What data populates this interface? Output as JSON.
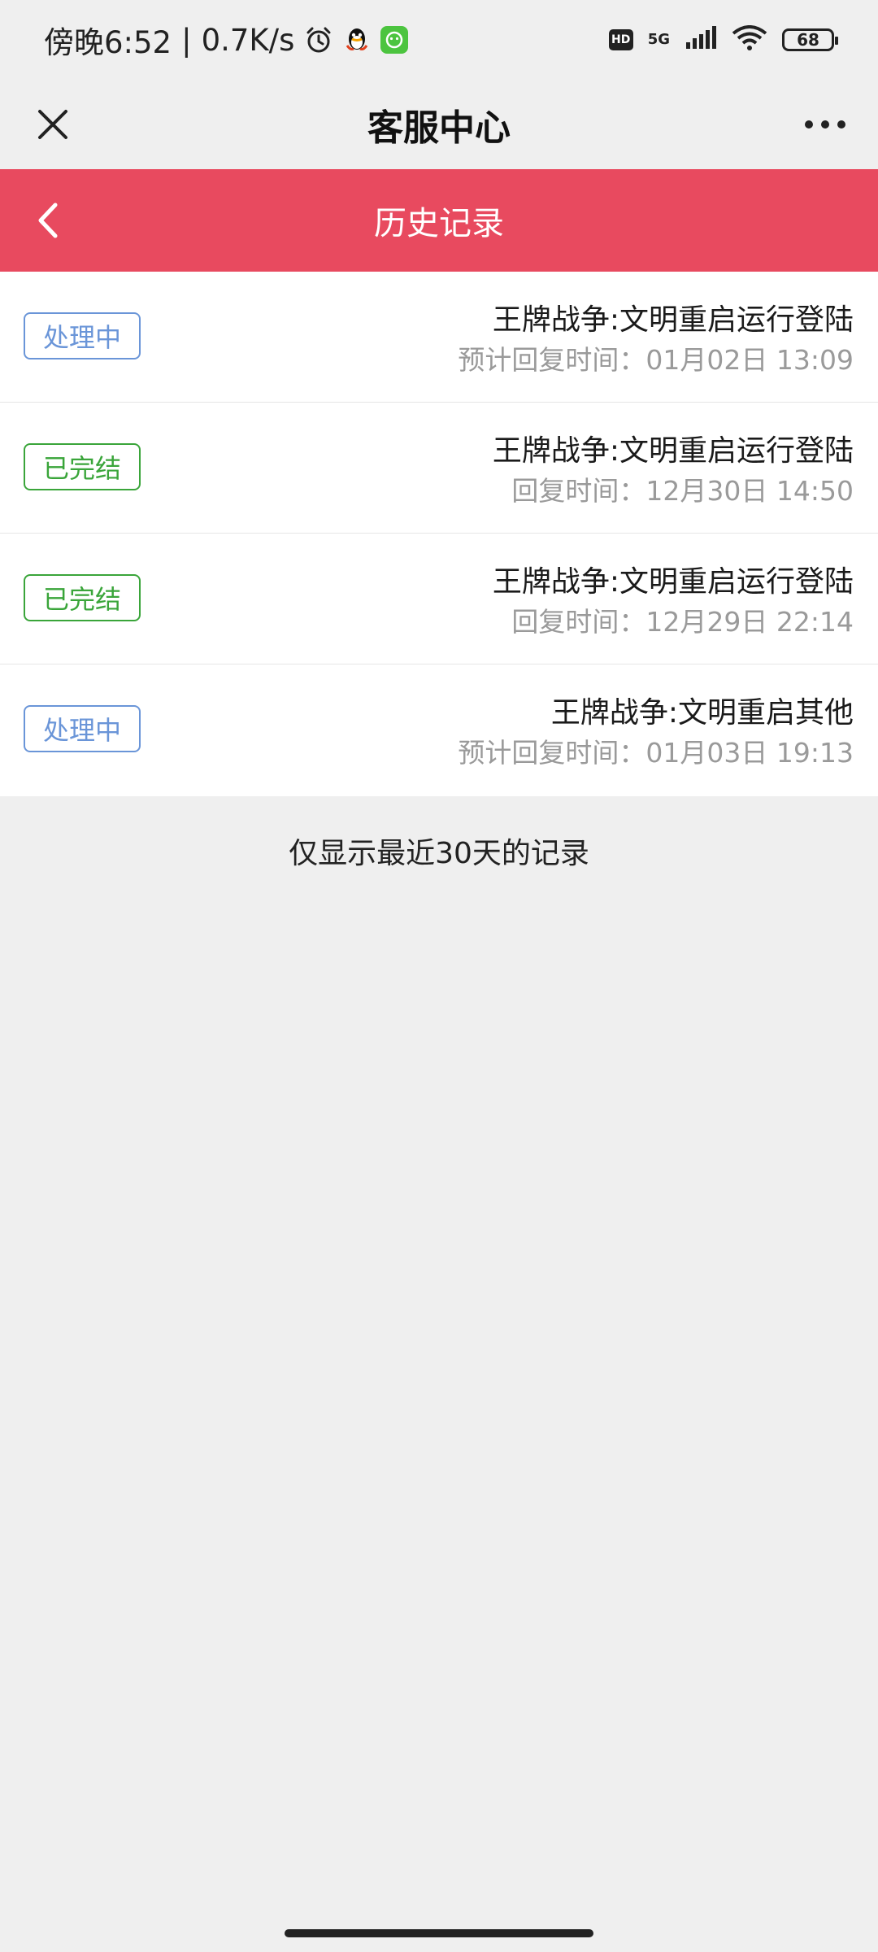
{
  "status_bar": {
    "time": "傍晚6:52",
    "network_speed": "0.7K/s",
    "icons_left": [
      "alarm-icon",
      "qq-icon",
      "app-badge-icon"
    ],
    "hd": "HD",
    "network_type": "5G",
    "battery": "68"
  },
  "title_bar": {
    "title": "客服中心",
    "close_icon": "close-icon",
    "more_icon": "more-icon"
  },
  "header": {
    "title": "历史记录",
    "back_icon": "chevron-left-icon",
    "color": "#e84a5f"
  },
  "records": [
    {
      "status": "处理中",
      "status_type": "processing",
      "title": "王牌战争:文明重启运行登陆",
      "time": "预计回复时间：01月02日 13:09"
    },
    {
      "status": "已完结",
      "status_type": "done",
      "title": "王牌战争:文明重启运行登陆",
      "time": "回复时间：12月30日 14:50"
    },
    {
      "status": "已完结",
      "status_type": "done",
      "title": "王牌战争:文明重启运行登陆",
      "time": "回复时间：12月29日 22:14"
    },
    {
      "status": "处理中",
      "status_type": "processing",
      "title": "王牌战争:文明重启其他",
      "time": "预计回复时间：01月03日 19:13"
    }
  ],
  "footer_note": "仅显示最近30天的记录",
  "colors": {
    "processing": "#6a95d8",
    "done": "#3aa53a"
  }
}
